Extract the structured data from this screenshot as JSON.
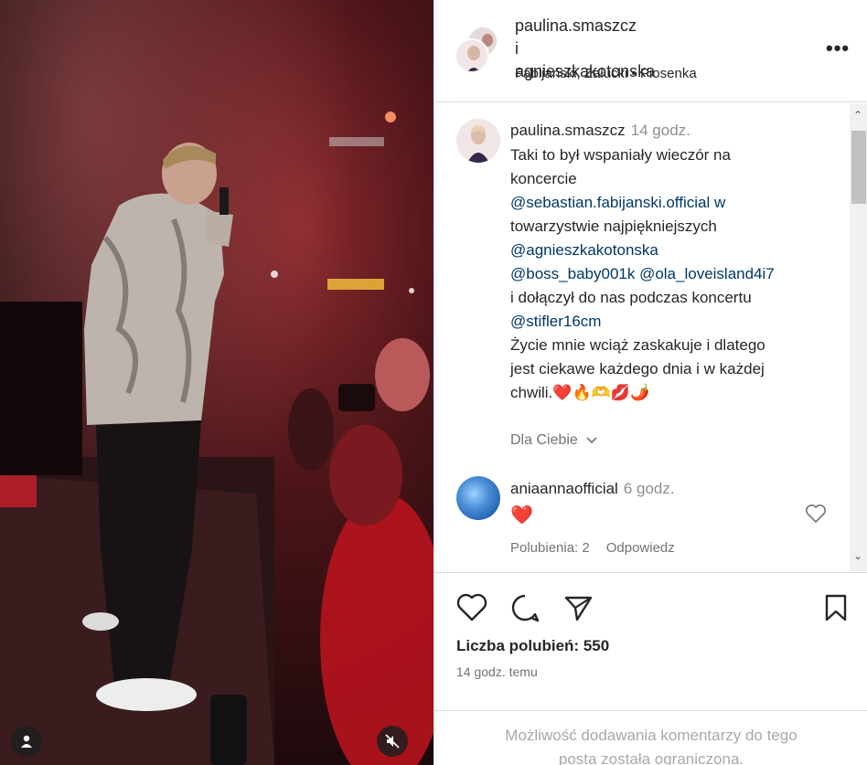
{
  "header": {
    "user1": "paulina.smaszcz",
    "connector": "i",
    "user2": "agnieszkakotonska",
    "subtitle": "Fabijański, Załucki • Piosenka",
    "more_icon": "more-horizontal-icon"
  },
  "caption": {
    "username": "paulina.smaszcz",
    "time": "14 godz.",
    "lines": [
      "Taki to był wspaniały wieczór na",
      "koncercie",
      "@sebastian.fabijanski.official w",
      "towarzystwie najpiękniejszych",
      "@agnieszkakotonska",
      "@boss_baby001k @ola_loveisland4i7",
      "i dołączył do nas podczas koncertu",
      "@stifler16cm",
      "Życie mnie wciąż zaskakuje i dlatego",
      "jest ciekawe każdego dnia i w każdej",
      "chwili.❤️🔥🫶💋🌶️"
    ],
    "translation_label": "Dla Ciebie"
  },
  "comment": {
    "username": "aniaannaofficial",
    "time": "6 godz.",
    "text": "❤️",
    "likes_label": "Polubienia: 2",
    "reply_label": "Odpowiedz"
  },
  "actions": {
    "likes_text": "Liczba polubień: 550",
    "time_ago": "14 godz. temu"
  },
  "comments_limited": {
    "line1": "Możliwość dodawania komentarzy do tego",
    "line2": "posta została ograniczona."
  },
  "colors": {
    "mention": "#00376b",
    "heart": "#e0102e",
    "muted": "#737373"
  }
}
